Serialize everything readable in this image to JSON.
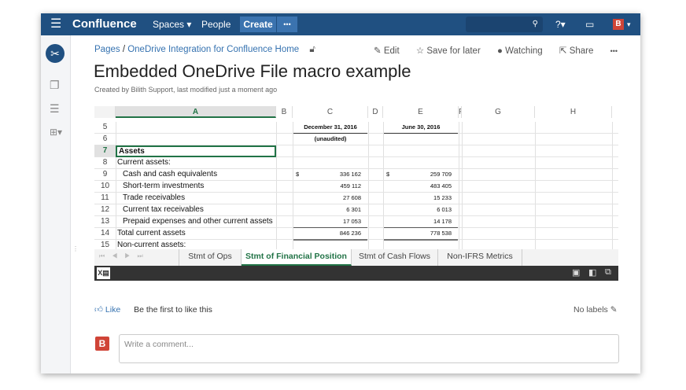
{
  "header": {
    "logo": "Confluence",
    "spaces": "Spaces",
    "people": "People",
    "create": "Create",
    "more": "•••",
    "avatar": "B"
  },
  "breadcrumb": {
    "pages": "Pages",
    "separator": "/",
    "space": "OneDrive Integration for Confluence Home"
  },
  "actions": {
    "edit": "Edit",
    "save": "Save for later",
    "watching": "Watching",
    "share": "Share",
    "more": "•••"
  },
  "page": {
    "title": "Embedded OneDrive File macro example",
    "meta": "Created by Bilith Support, last modified just a moment ago"
  },
  "sheet": {
    "columns": [
      "A",
      "B",
      "C",
      "D",
      "E",
      "F",
      "G",
      "H"
    ],
    "rows": [
      {
        "n": "5",
        "a": "",
        "c": "December 31, 2016",
        "e": "June 30, 2016"
      },
      {
        "n": "6",
        "a": "",
        "c": "(unaudited)",
        "e": ""
      },
      {
        "n": "7",
        "a": "Assets",
        "c": "",
        "e": ""
      },
      {
        "n": "8",
        "a": "Current assets:",
        "c": "",
        "e": ""
      },
      {
        "n": "9",
        "a": "Cash and cash equivalents",
        "c": "336 162",
        "e": "259 709",
        "cur": "$"
      },
      {
        "n": "10",
        "a": "Short-term investments",
        "c": "459 112",
        "e": "483 405"
      },
      {
        "n": "11",
        "a": "Trade receivables",
        "c": "27 608",
        "e": "15 233"
      },
      {
        "n": "12",
        "a": "Current tax receivables",
        "c": "6 301",
        "e": "6 013"
      },
      {
        "n": "13",
        "a": "Prepaid expenses and other current assets",
        "c": "17 053",
        "e": "14 178"
      },
      {
        "n": "14",
        "a": "Total current assets",
        "c": "846 236",
        "e": "778 538"
      },
      {
        "n": "15",
        "a": "Non-current assets:",
        "c": "",
        "e": ""
      }
    ],
    "tabs": [
      "Stmt of Ops",
      "Stmt of Financial Position",
      "Stmt of Cash Flows",
      "Non-IFRS Metrics"
    ],
    "active_tab": "Stmt of Financial Position"
  },
  "footer": {
    "like": "Like",
    "like_text": "Be the first to like this",
    "labels": "No labels",
    "comment_placeholder": "Write a comment...",
    "avatar": "B"
  },
  "colors": {
    "header": "#205081",
    "accent": "#217346",
    "avatar": "#d04437"
  }
}
